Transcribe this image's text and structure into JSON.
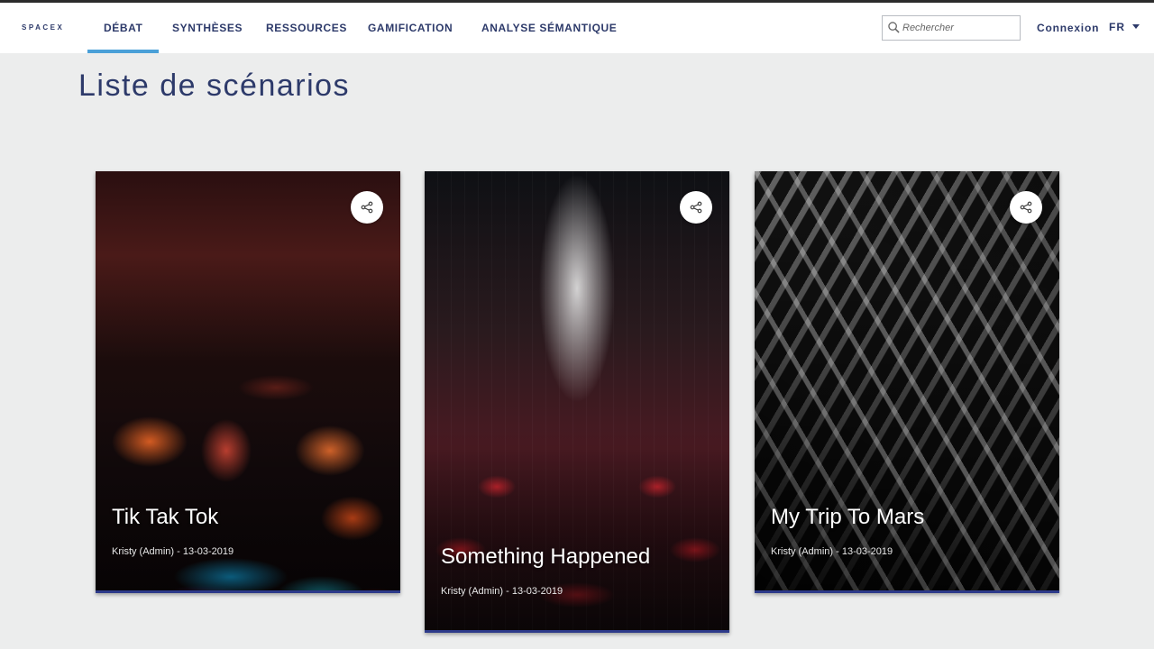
{
  "header": {
    "logo_text": "SPACEX",
    "nav": [
      {
        "label": "DÉBAT",
        "active": true
      },
      {
        "label": "SYNTHÈSES",
        "active": false
      },
      {
        "label": "RESSOURCES",
        "active": false
      },
      {
        "label": "GAMIFICATION",
        "active": false
      },
      {
        "label": "ANALYSE SÉMANTIQUE",
        "active": false
      }
    ],
    "search": {
      "placeholder": "Rechercher",
      "value": ""
    },
    "login_label": "Connexion",
    "language": "FR"
  },
  "main": {
    "title": "Liste de scénarios",
    "cards": [
      {
        "title": "Tik Tak Tok",
        "author": "Kristy (Admin)",
        "date": "13-03-2019",
        "share_icon": "share-icon"
      },
      {
        "title": "Something Happened",
        "author": "Kristy (Admin)",
        "date": "13-03-2019",
        "share_icon": "share-icon"
      },
      {
        "title": "My Trip To Mars",
        "author": "Kristy (Admin)",
        "date": "13-03-2019",
        "share_icon": "share-icon"
      }
    ]
  },
  "colors": {
    "brand": "#2d3a6a",
    "nav_active_underline": "#4aa0d8",
    "page_bg": "#eceded",
    "card_bar": "#2d3a8a"
  }
}
